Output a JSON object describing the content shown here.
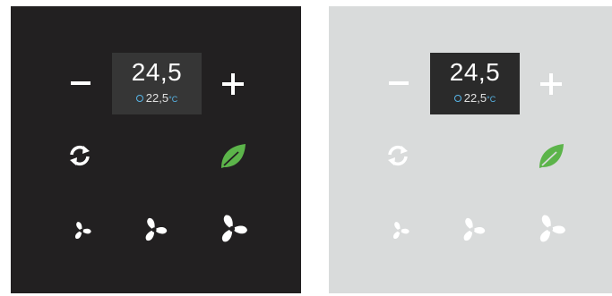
{
  "panels": [
    {
      "theme": "dark",
      "display": {
        "setpoint": "24,5",
        "current_temp": "22,5",
        "current_unit": "°C"
      },
      "icons": [
        "minus-icon",
        "plus-icon",
        "mode-cycle-icon",
        "eco-leaf-icon",
        "fan-speed-1-icon",
        "fan-speed-2-icon",
        "fan-speed-3-icon"
      ]
    },
    {
      "theme": "light",
      "display": {
        "setpoint": "24,5",
        "current_temp": "22,5",
        "current_unit": "°C"
      },
      "icons": [
        "minus-icon",
        "plus-icon",
        "mode-cycle-icon",
        "eco-leaf-icon",
        "fan-speed-1-icon",
        "fan-speed-2-icon",
        "fan-speed-3-icon"
      ]
    }
  ],
  "colors": {
    "dark_panel_bg": "#222021",
    "light_panel_bg": "#d9dbdb",
    "display_bg": "#363636",
    "accent_blue": "#58b6e8",
    "eco_green": "#5cb44a",
    "icon_white": "#ffffff"
  }
}
